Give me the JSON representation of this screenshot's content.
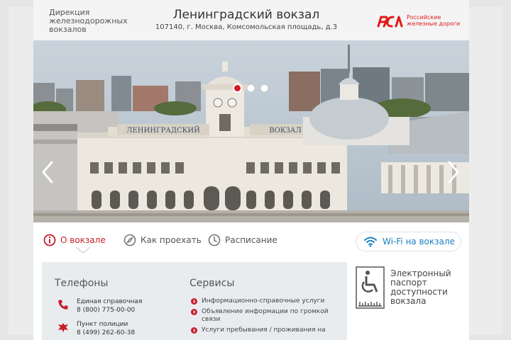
{
  "header": {
    "org_lines": [
      "Дирекция",
      "железнодорожных",
      "вокзалов"
    ],
    "station_title": "Ленинградский вокзал",
    "address": "107140, г. Москва, Комсомольская площадь, д.3",
    "logo_lines": [
      "Российские",
      "железные дороги"
    ],
    "logo_icon": "rzd-logo",
    "accent_color": "#e21a1a"
  },
  "hero": {
    "building_sign_left": "ЛЕНИНГРАДСКИЙ",
    "building_sign_right": "ВОКЗАЛ",
    "slides_total": 3,
    "active_slide": 1
  },
  "tabs": [
    {
      "label": "О вокзале",
      "icon": "info-icon",
      "active": true
    },
    {
      "label": "Как проехать",
      "icon": "compass-icon",
      "active": false
    },
    {
      "label": "Расписание",
      "icon": "clock-icon",
      "active": false
    }
  ],
  "wifi": {
    "label": "Wi-Fi на вокзале",
    "icon": "wifi-icon",
    "color": "#1a7fc1"
  },
  "phones": {
    "heading": "Телефоны",
    "items": [
      {
        "title": "Единая справочная",
        "number": "8 (800) 775-00-00",
        "icon": "phone-icon"
      },
      {
        "title": "Пункт полиции",
        "number": "8 (499) 262-60-38",
        "icon": "police-emblem-icon"
      }
    ]
  },
  "services": {
    "heading": "Сервисы",
    "items": [
      "Информационно-справочные услуги",
      "Объявление информации по громкой связи",
      "Услуги пребывания / проживания на"
    ]
  },
  "passport": {
    "label": "Электронный паспорт доступности вокзала",
    "icon": "accessibility-icon"
  }
}
